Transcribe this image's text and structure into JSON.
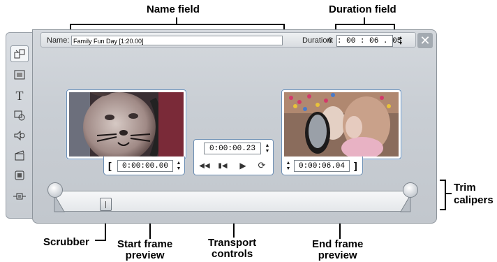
{
  "callouts": {
    "name_field": "Name field",
    "duration_field": "Duration field",
    "trim_calipers": "Trim\ncalipers",
    "scrubber": "Scrubber",
    "start_frame": "Start frame\npreview",
    "transport": "Transport\ncontrols",
    "end_frame": "End frame\npreview"
  },
  "editor": {
    "name_label": "Name:",
    "name_value": "Family Fun Day [1:20.00]",
    "duration_label": "Duration:",
    "duration_value": "0 : 00 : 06 . 05",
    "close_icon": "close-icon"
  },
  "start_frame": {
    "bracket": "[",
    "time": "0:00:00.00"
  },
  "end_frame": {
    "bracket": "]",
    "time": "0:00:06.04"
  },
  "transport": {
    "time": "0:00:00.23",
    "buttons": [
      "go-to-start-icon",
      "step-back-icon",
      "play-icon",
      "loop-icon"
    ]
  },
  "sidebar": {
    "tools": [
      "video-tool-icon",
      "title-tool-icon",
      "text-tool-icon",
      "effects-tool-icon",
      "audio-tool-icon",
      "clapper-tool-icon",
      "stop-tool-icon",
      "plugin-tool-icon"
    ],
    "active_index": 0
  },
  "scrubber": {
    "position": 0.14
  },
  "colors": {
    "frame_border": "#6d8fb4",
    "panel": "#c9ced4"
  }
}
